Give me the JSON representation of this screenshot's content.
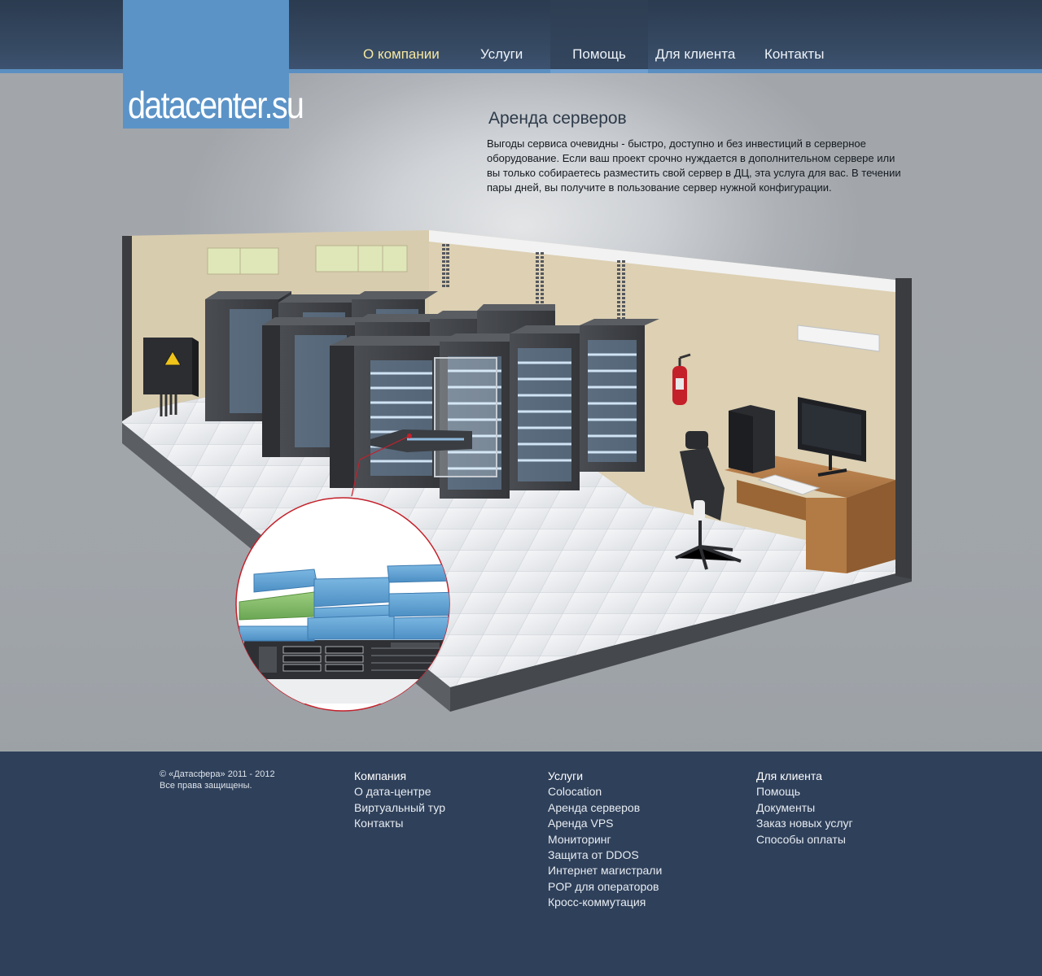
{
  "brand": {
    "logo_text": "datacenter.su",
    "accent_color": "#5b93c7"
  },
  "nav": {
    "items": [
      {
        "label": "О компании",
        "state": "current"
      },
      {
        "label": "Услуги",
        "state": "normal"
      },
      {
        "label": "Помощь",
        "state": "active"
      },
      {
        "label": "Для клиента",
        "state": "normal"
      },
      {
        "label": "Контакты",
        "state": "normal"
      }
    ]
  },
  "content": {
    "title": "Аренда серверов",
    "intro": "Выгоды сервиса очевидны - быстро, доступно и без инвестиций в серверное оборудование. Если ваш проект срочно нуждается в дополнительном сервере или вы только собираетесь разместить свой сервер в ДЦ, эта услуга для вас. В течении пары дней, вы получите в пользование сервер нужной конфигурации."
  },
  "illustration": {
    "scene": "datacenter-room",
    "icons": [
      "electrical-panel-icon",
      "warning-triangle-icon",
      "server-rack-icon",
      "fire-extinguisher-icon",
      "air-conditioner-icon",
      "office-chair-icon",
      "desk-icon",
      "pc-tower-icon",
      "monitor-icon",
      "keyboard-icon",
      "server-unit-icon"
    ],
    "colors": {
      "highlight_green": "#7bb664",
      "highlight_blue": "#62a3d4",
      "callout_ring": "#c4202a"
    }
  },
  "footer": {
    "copyright_line1": "© «Датасфера» 2011 - 2012",
    "copyright_line2": "Все права защищены.",
    "columns": [
      {
        "links": [
          "Компания",
          "О дата-центре",
          "Виртуальный тур",
          "Контакты"
        ]
      },
      {
        "links": [
          "Услуги",
          "Colocation",
          "Аренда серверов",
          "Аренда VPS",
          "Мониторинг",
          "Защита от DDOS",
          "Интернет магистрали",
          "POP для операторов",
          "Кросс-коммутация"
        ]
      },
      {
        "links": [
          "Для клиента",
          "Помощь",
          "Документы",
          "Заказ новых услуг",
          "Способы оплаты"
        ]
      }
    ]
  }
}
